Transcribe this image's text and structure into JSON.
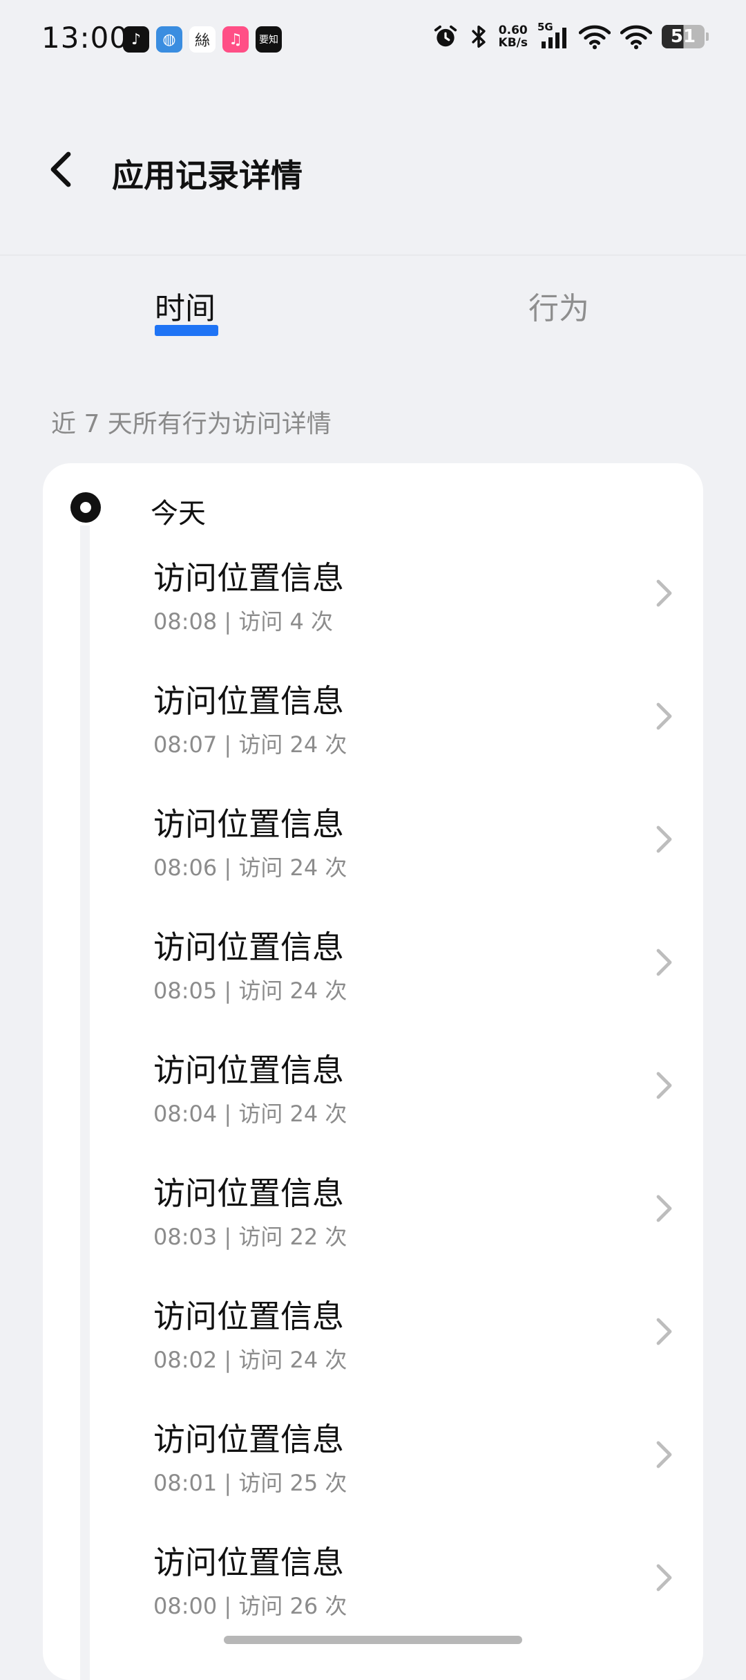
{
  "status_bar": {
    "time": "13:00",
    "notification_icons": [
      {
        "name": "tiktok-icon",
        "bg": "#111111",
        "glyph": "♪"
      },
      {
        "name": "browser-icon",
        "bg": "#3a8de0",
        "glyph": "◍"
      },
      {
        "name": "calligraphy-app-icon",
        "bg": "#ffffff",
        "glyph": "絲"
      },
      {
        "name": "music-app-icon",
        "bg": "#ff4f86",
        "glyph": "♫"
      },
      {
        "name": "news-app-icon",
        "bg": "#111111",
        "glyph": "要知"
      }
    ],
    "net_speed_value": "0.60",
    "net_speed_unit": "KB/s",
    "network_type": "5G",
    "battery_level": "51"
  },
  "header": {
    "title": "应用记录详情"
  },
  "tabs": {
    "time": "时间",
    "behavior": "行为"
  },
  "section": {
    "subtitle": "近 7 天所有行为访问详情"
  },
  "timeline": {
    "day_label": "今天",
    "items": [
      {
        "title": "访问位置信息",
        "detail": "08:08 | 访问 4 次"
      },
      {
        "title": "访问位置信息",
        "detail": "08:07 | 访问 24 次"
      },
      {
        "title": "访问位置信息",
        "detail": "08:06 | 访问 24 次"
      },
      {
        "title": "访问位置信息",
        "detail": "08:05 | 访问 24 次"
      },
      {
        "title": "访问位置信息",
        "detail": "08:04 | 访问 24 次"
      },
      {
        "title": "访问位置信息",
        "detail": "08:03 | 访问 22 次"
      },
      {
        "title": "访问位置信息",
        "detail": "08:02 | 访问 24 次"
      },
      {
        "title": "访问位置信息",
        "detail": "08:01 | 访问 25 次"
      },
      {
        "title": "访问位置信息",
        "detail": "08:00 | 访问 26 次"
      }
    ]
  },
  "colors": {
    "accent": "#1f74f5",
    "background": "#f0f1f4",
    "card": "#ffffff",
    "secondary_text": "#8c8c8c"
  }
}
